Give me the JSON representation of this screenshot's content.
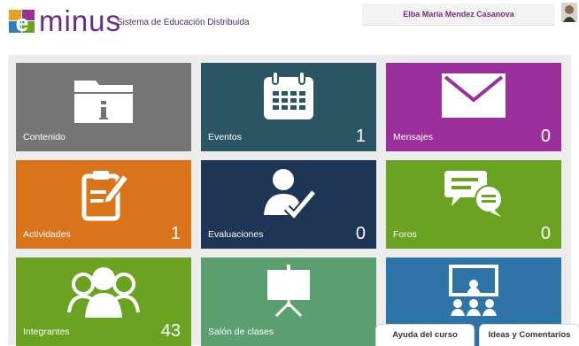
{
  "header": {
    "logo_text": "minus",
    "tagline": "Sistema de Educación Distribuida",
    "user_name": "Elba María Mendez Casanova"
  },
  "tiles": [
    {
      "label": "Contenido",
      "count": "",
      "color": "#757575",
      "icon": "folder-info-icon"
    },
    {
      "label": "Eventos",
      "count": "1",
      "color": "#2b5563",
      "icon": "calendar-icon"
    },
    {
      "label": "Mensajes",
      "count": "0",
      "color": "#9b2f9b",
      "icon": "envelope-icon"
    },
    {
      "label": "Actividades",
      "count": "1",
      "color": "#d9741a",
      "icon": "clipboard-pencil-icon"
    },
    {
      "label": "Evaluaciones",
      "count": "0",
      "color": "#1e3555",
      "icon": "user-check-icon"
    },
    {
      "label": "Foros",
      "count": "0",
      "color": "#6aa321",
      "icon": "chat-bubbles-icon"
    },
    {
      "label": "Integrantes",
      "count": "43",
      "color": "#6aa321",
      "icon": "group-icon"
    },
    {
      "label": "Salón de clases",
      "count": "",
      "color": "#5b9e6f",
      "icon": "presentation-board-icon"
    },
    {
      "label": "",
      "count": "",
      "color": "#2f74a8",
      "icon": "classroom-screen-icon"
    }
  ],
  "footer": {
    "help_label": "Ayuda del curso",
    "ideas_label": "Ideas y Comentarios"
  }
}
